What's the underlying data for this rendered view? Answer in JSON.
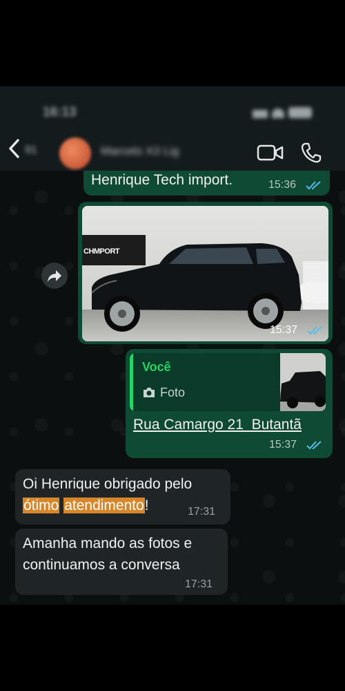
{
  "status_bar": {
    "time": "16:13"
  },
  "header": {
    "back_count": "91",
    "contact_name": "Marcelo X3 Lig"
  },
  "messages": [
    {
      "type": "out",
      "text": "Henrique Tech import.",
      "time": "15:36",
      "read": true
    },
    {
      "type": "out-photo",
      "showroom_sign": "CHMPORT",
      "time": "15:37",
      "read": true
    },
    {
      "type": "out-reply",
      "quoted_author": "Você",
      "quoted_label": "Foto",
      "text_part1": "Rua Camargo 21",
      "text_part2": "Butantã",
      "time": "15:37",
      "read": true
    },
    {
      "type": "in",
      "text_before": "Oi Henrique obrigado pelo",
      "highlight1": "ótimo",
      "highlight2": "atendimento",
      "text_after": "!",
      "time": "17:31"
    },
    {
      "type": "in",
      "line1": "Amanha mando as fotos e",
      "line2": "continuamos a conversa",
      "time": "17:31"
    }
  ],
  "colors": {
    "accent_green": "#25d366",
    "outgoing_bubble": "#0f4a34",
    "incoming_bubble": "#1f2527",
    "read_ticks": "#53bdeb",
    "highlight": "#d8862a"
  }
}
